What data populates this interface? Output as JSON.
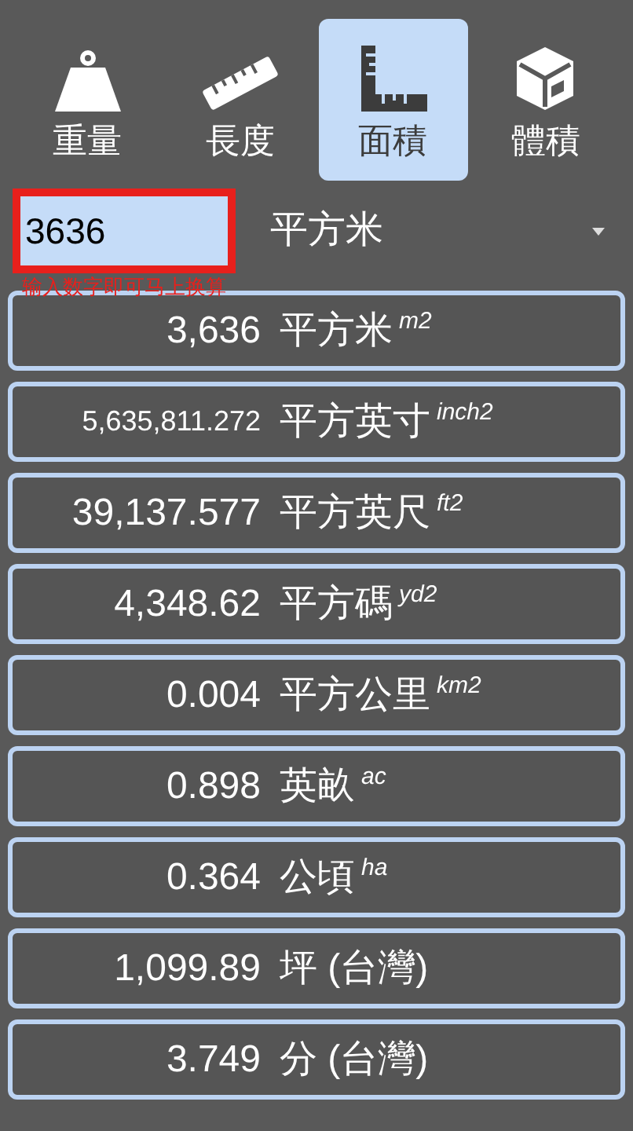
{
  "tabs": [
    {
      "kind": "weight",
      "label": "重量",
      "selected": false
    },
    {
      "kind": "length",
      "label": "長度",
      "selected": false
    },
    {
      "kind": "area",
      "label": "面積",
      "selected": true
    },
    {
      "kind": "volume",
      "label": "體積",
      "selected": false
    }
  ],
  "input": {
    "value": "3636",
    "annotation": "输入数字即可马上换算"
  },
  "unit_select": {
    "value": "平方米"
  },
  "results": [
    {
      "value": "3,636",
      "unit": "平方米",
      "symbol": "m2"
    },
    {
      "value": "5,635,811.272",
      "unit": "平方英寸",
      "symbol": "inch2"
    },
    {
      "value": "39,137.577",
      "unit": "平方英尺",
      "symbol": "ft2"
    },
    {
      "value": "4,348.62",
      "unit": "平方碼",
      "symbol": "yd2"
    },
    {
      "value": "0.004",
      "unit": "平方公里",
      "symbol": "km2"
    },
    {
      "value": "0.898",
      "unit": "英畝",
      "symbol": "ac"
    },
    {
      "value": "0.364",
      "unit": "公頃",
      "symbol": "ha"
    },
    {
      "value": "1,099.89",
      "unit": "坪 (台灣)"
    },
    {
      "value": "3.749",
      "unit": "分 (台灣)"
    }
  ]
}
